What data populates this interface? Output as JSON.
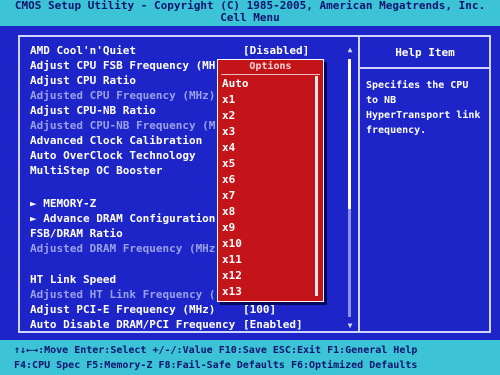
{
  "title": {
    "line1": "CMOS Setup Utility - Copyright (C) 1985-2005, American Megatrends, Inc.",
    "line2": "Cell Menu"
  },
  "menu": {
    "group1": [
      {
        "label": "AMD Cool'n'Quiet",
        "value": "[Disabled]",
        "enabled": true
      },
      {
        "label": "Adjust CPU FSB Frequency (MH",
        "value": "",
        "enabled": true
      },
      {
        "label": "Adjust CPU Ratio",
        "value": "",
        "enabled": true
      },
      {
        "label": "Adjusted CPU Frequency (MHz)",
        "value": "",
        "enabled": false
      },
      {
        "label": "Adjust CPU-NB Ratio",
        "value": "",
        "enabled": true
      },
      {
        "label": "Adjusted CPU-NB Frequency (M",
        "value": "",
        "enabled": false
      },
      {
        "label": "Advanced Clock Calibration",
        "value": "",
        "enabled": true
      },
      {
        "label": "Auto OverClock Technology",
        "value": "",
        "enabled": true
      },
      {
        "label": "MultiStep OC Booster",
        "value": "",
        "enabled": true
      }
    ],
    "group2": [
      {
        "label": "► MEMORY-Z",
        "value": "",
        "enabled": true
      },
      {
        "label": "► Advance DRAM Configuration",
        "value": "",
        "enabled": true
      },
      {
        "label": "FSB/DRAM Ratio",
        "value": "",
        "enabled": true
      },
      {
        "label": "Adjusted DRAM Frequency (MHz",
        "value": "",
        "enabled": false
      }
    ],
    "group3": [
      {
        "label": "HT Link Speed",
        "value": "",
        "enabled": true
      },
      {
        "label": "Adjusted HT Link Frequency (",
        "value": "",
        "enabled": false
      },
      {
        "label": "Adjust PCI-E Frequency (MHz)",
        "value": "[100]",
        "enabled": true
      },
      {
        "label": "Auto Disable DRAM/PCI Frequency",
        "value": "[Enabled]",
        "enabled": true
      }
    ]
  },
  "popup": {
    "title": "Options",
    "options": [
      "Auto",
      "x1",
      "x2",
      "x3",
      "x4",
      "x5",
      "x6",
      "x7",
      "x8",
      "x9",
      "x10",
      "x11",
      "x12",
      "x13"
    ],
    "selected": "Auto"
  },
  "help": {
    "title": "Help Item",
    "text": "Specifies the CPU to NB HyperTransport link frequency."
  },
  "footer": {
    "line1": "↑↓←→:Move  Enter:Select  +/-/:Value  F10:Save  ESC:Exit  F1:General Help",
    "line2": "F4:CPU Spec  F5:Memory-Z  F8:Fail-Safe Defaults     F6:Optimized Defaults"
  },
  "colors": {
    "background": "#1d25c8",
    "bar": "#3dc3d6",
    "popup": "#c31519",
    "dim_text": "#9aa0e6"
  }
}
